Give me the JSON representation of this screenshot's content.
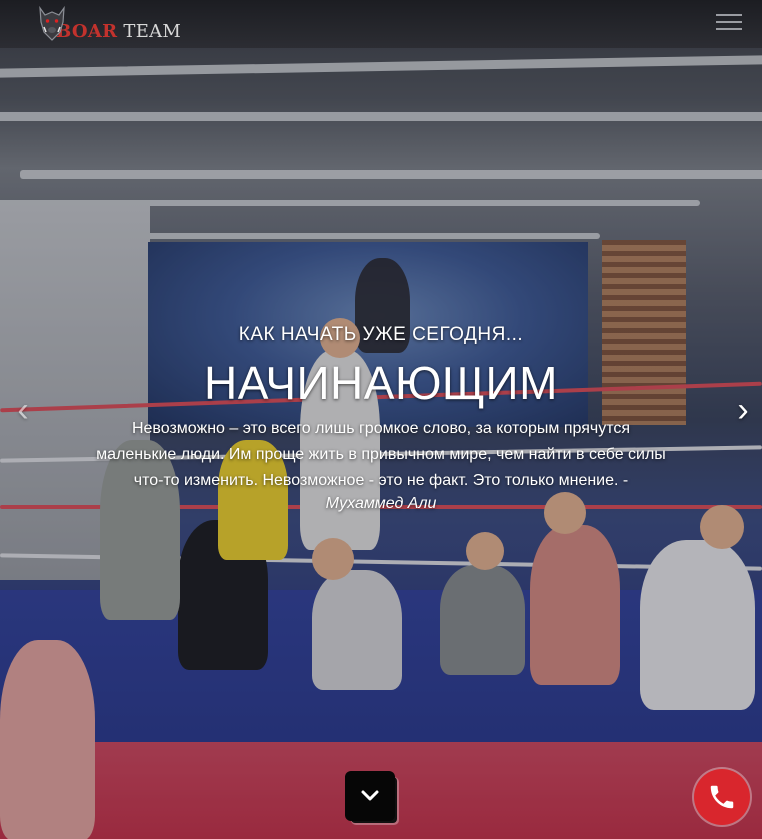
{
  "header": {
    "logo_word_1": "BOAR",
    "logo_word_2": "TEAM",
    "logo_icon": "boar-head-icon",
    "menu_icon": "hamburger-menu-icon"
  },
  "hero": {
    "kicker": "КАК НАЧАТЬ УЖЕ СЕГОДНЯ...",
    "title": "НАЧИНАЮЩИМ",
    "quote": "Невозможно – это всего лишь громкое слово, за которым прячутся маленькие люди. Им проще жить в привычном мире, чем найти в себе силы что-то изменить. Невозможное - это не факт. Это только мнение. -",
    "author": "Мухаммед Али",
    "prev_icon": "chevron-left-icon",
    "next_icon": "chevron-right-icon"
  },
  "actions": {
    "scroll_icon": "chevron-down-icon",
    "call_icon": "phone-icon"
  },
  "colors": {
    "accent_red": "#d9262d",
    "header_bg": "#1c1d22",
    "ring_blue": "#2f3d84",
    "mat_red": "#d24459"
  }
}
